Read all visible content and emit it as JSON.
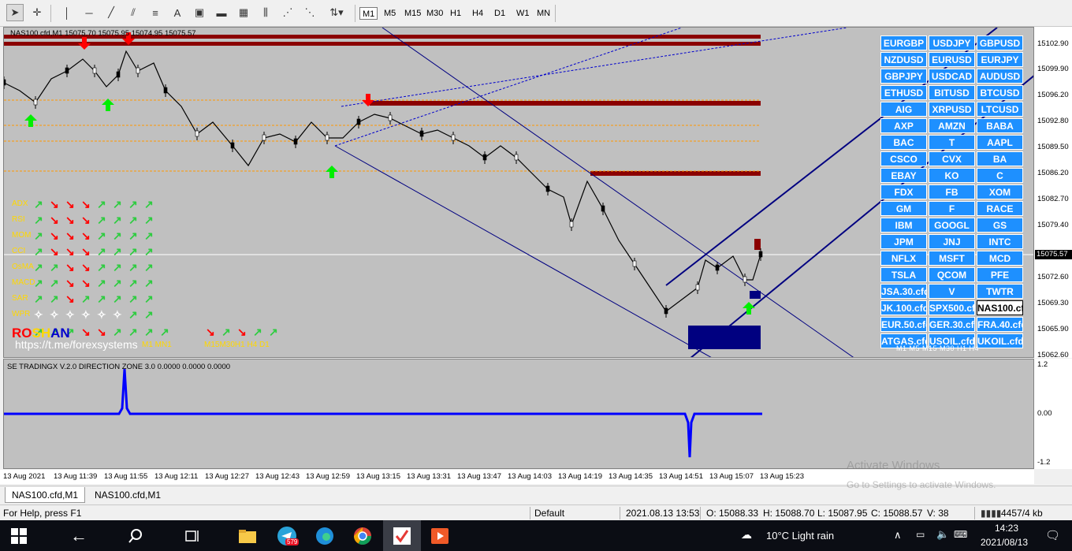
{
  "toolbar": {
    "timeframes": [
      "M1",
      "M5",
      "M15",
      "M30",
      "H1",
      "H4",
      "D1",
      "W1",
      "MN"
    ],
    "active_timeframe": "M1"
  },
  "chart": {
    "title": "NAS100.cfd,M1  15075.70 15075.95 15074.95 15075.57",
    "current_price": "15075.57",
    "price_labels": [
      "15102.90",
      "15099.90",
      "15096.20",
      "15092.80",
      "15089.50",
      "15086.20",
      "15082.70",
      "15079.40",
      "15075.57",
      "15072.60",
      "15069.30",
      "15065.90",
      "15062.60"
    ],
    "branding": {
      "text": "ROSHAN",
      "letters": [
        "RO",
        "SH",
        "AN"
      ],
      "colors": [
        "#ff0000",
        "#ffd700",
        "#0000cd"
      ],
      "url": "https://t.me/forexsystems"
    },
    "indicators": [
      "ADX",
      "RSI",
      "MOM",
      "CCI",
      "OsMA",
      "MACD",
      "SAR",
      "WPR"
    ],
    "tf_row_main": "M1 MN1",
    "tf_row_right": "M15M30H1  H4  D1"
  },
  "symbols": [
    [
      "EURGBP",
      "USDJPY",
      "GBPUSD"
    ],
    [
      "NZDUSD",
      "EURUSD",
      "EURJPY"
    ],
    [
      "GBPJPY",
      "USDCAD",
      "AUDUSD"
    ],
    [
      "ETHUSD",
      "BITUSD",
      "BTCUSD"
    ],
    [
      "AIG",
      "XRPUSD",
      "LTCUSD"
    ],
    [
      "AXP",
      "AMZN",
      "BABA"
    ],
    [
      "BAC",
      "T",
      "AAPL"
    ],
    [
      "CSCO",
      "CVX",
      "BA"
    ],
    [
      "EBAY",
      "KO",
      "C"
    ],
    [
      "FDX",
      "FB",
      "XOM"
    ],
    [
      "GM",
      "F",
      "RACE"
    ],
    [
      "IBM",
      "GOOGL",
      "GS"
    ],
    [
      "JPM",
      "JNJ",
      "INTC"
    ],
    [
      "NFLX",
      "MSFT",
      "MCD"
    ],
    [
      "TSLA",
      "QCOM",
      "PFE"
    ],
    [
      "JSA.30.cfd",
      "V",
      "TWTR"
    ],
    [
      "JK.100.cfd",
      "SPX500.cfd",
      "NAS100.cfd"
    ],
    [
      "EUR.50.cfd",
      "GER.30.cfd",
      "FRA.40.cfd"
    ],
    [
      "ATGAS.cfd",
      "USOIL.cfd",
      "UKOIL.cfd"
    ]
  ],
  "symbol_tf_row": "M1  M5  M15 M30  H1  H4",
  "subchart": {
    "title": "SE TRADINGX V.2.0 DIRECTION ZONE 3.0 0.0000 0.0000 0.0000",
    "axis_labels": [
      "1.2",
      "0.00",
      "-1.2"
    ]
  },
  "time_labels": [
    "13 Aug 2021",
    "13 Aug 11:39",
    "13 Aug 11:55",
    "13 Aug 12:11",
    "13 Aug 12:27",
    "13 Aug 12:43",
    "13 Aug 12:59",
    "13 Aug 13:15",
    "13 Aug 13:31",
    "13 Aug 13:47",
    "13 Aug 14:03",
    "13 Aug 14:19",
    "13 Aug 14:35",
    "13 Aug 14:51",
    "13 Aug 15:07",
    "13 Aug 15:23"
  ],
  "tabs": [
    "NAS100.cfd,M1",
    "NAS100.cfd,M1"
  ],
  "status": {
    "help": "For Help, press F1",
    "profile": "Default",
    "datetime": "2021.08.13 13:53",
    "open": "O: 15088.33",
    "high": "H: 15088.70",
    "low": "L: 15087.95",
    "close": "C: 15088.57",
    "volume": "V: 38",
    "traffic": "4457/4 kb"
  },
  "watermark": {
    "line1": "Activate Windows",
    "line2": "Go to Settings to activate Windows."
  },
  "taskbar": {
    "weather": "10°C  Light rain",
    "time": "14:23",
    "date": "2021/08/13",
    "telegram_badge": "579"
  }
}
